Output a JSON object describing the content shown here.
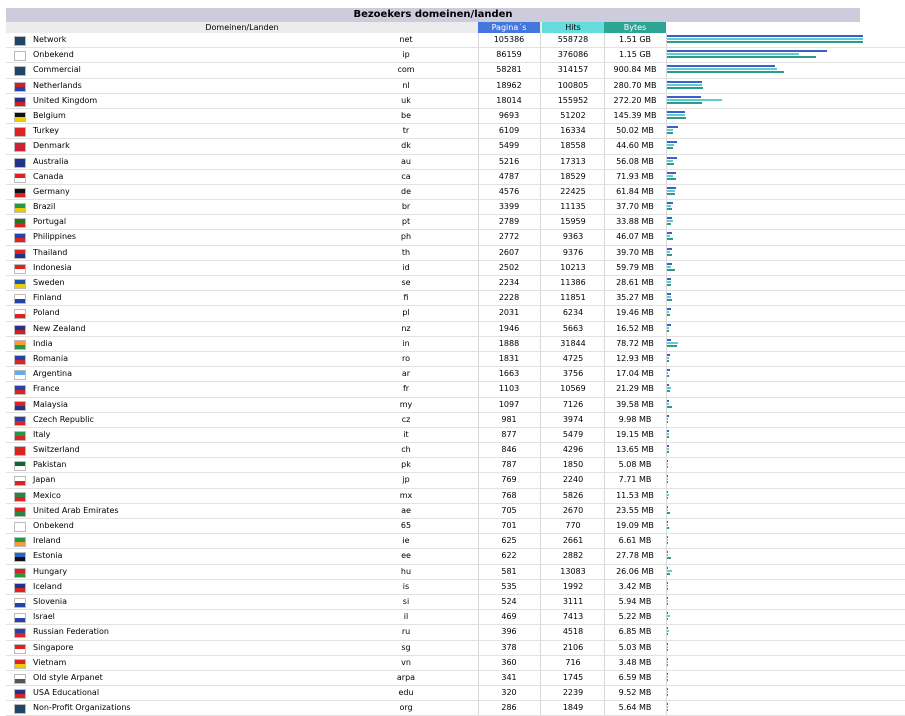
{
  "title": "Bezoekers domeinen/landen",
  "headers": {
    "domain": "Domeinen/Landen",
    "pages": "Pagina´s",
    "hits": "Hits",
    "bytes": "Bytes"
  },
  "colors": {
    "title_bg": "#ccccdd",
    "pages": "#4477dd",
    "hits": "#66dddd",
    "bytes": "#2ea495"
  },
  "rows": [
    {
      "icon": "network-globe-icon",
      "flag": [
        "#224466",
        "#224466"
      ],
      "name": "Network",
      "code": "net",
      "pages": "105386",
      "hits": "558728",
      "bytes": "1.51 GB",
      "pv": 105386,
      "hv": 558728,
      "bv": 1.51
    },
    {
      "icon": "unknown-icon",
      "flag": [
        "#ffffff",
        "#ffffff"
      ],
      "name": "Onbekend",
      "code": "ip",
      "pages": "86159",
      "hits": "376086",
      "bytes": "1.15 GB",
      "pv": 86159,
      "hv": 376086,
      "bv": 1.15
    },
    {
      "icon": "commercial-globe-icon",
      "flag": [
        "#224466",
        "#224466"
      ],
      "name": "Commercial",
      "code": "com",
      "pages": "58281",
      "hits": "314157",
      "bytes": "900.84 MB",
      "pv": 58281,
      "hv": 314157,
      "bv": 0.90084
    },
    {
      "icon": "flag-nl-icon",
      "flag": [
        "#cc2222",
        "#2244aa"
      ],
      "name": "Netherlands",
      "code": "nl",
      "pages": "18962",
      "hits": "100805",
      "bytes": "280.70 MB",
      "pv": 18962,
      "hv": 100805,
      "bv": 0.2807
    },
    {
      "icon": "flag-uk-icon",
      "flag": [
        "#22338a",
        "#cc2222"
      ],
      "name": "United Kingdom",
      "code": "uk",
      "pages": "18014",
      "hits": "155952",
      "bytes": "272.20 MB",
      "pv": 18014,
      "hv": 155952,
      "bv": 0.2722
    },
    {
      "icon": "flag-be-icon",
      "flag": [
        "#111111",
        "#eecc00"
      ],
      "name": "Belgium",
      "code": "be",
      "pages": "9693",
      "hits": "51202",
      "bytes": "145.39 MB",
      "pv": 9693,
      "hv": 51202,
      "bv": 0.14539
    },
    {
      "icon": "flag-tr-icon",
      "flag": [
        "#dd2222",
        "#dd2222"
      ],
      "name": "Turkey",
      "code": "tr",
      "pages": "6109",
      "hits": "16334",
      "bytes": "50.02 MB",
      "pv": 6109,
      "hv": 16334,
      "bv": 0.05002
    },
    {
      "icon": "flag-dk-icon",
      "flag": [
        "#cc2233",
        "#cc2233"
      ],
      "name": "Denmark",
      "code": "dk",
      "pages": "5499",
      "hits": "18558",
      "bytes": "44.60 MB",
      "pv": 5499,
      "hv": 18558,
      "bv": 0.0446
    },
    {
      "icon": "flag-au-icon",
      "flag": [
        "#22338a",
        "#22338a"
      ],
      "name": "Australia",
      "code": "au",
      "pages": "5216",
      "hits": "17313",
      "bytes": "56.08 MB",
      "pv": 5216,
      "hv": 17313,
      "bv": 0.05608
    },
    {
      "icon": "flag-ca-icon",
      "flag": [
        "#dd2222",
        "#ffffff"
      ],
      "name": "Canada",
      "code": "ca",
      "pages": "4787",
      "hits": "18529",
      "bytes": "71.93 MB",
      "pv": 4787,
      "hv": 18529,
      "bv": 0.07193
    },
    {
      "icon": "flag-de-icon",
      "flag": [
        "#111111",
        "#dd2222"
      ],
      "name": "Germany",
      "code": "de",
      "pages": "4576",
      "hits": "22425",
      "bytes": "61.84 MB",
      "pv": 4576,
      "hv": 22425,
      "bv": 0.06184
    },
    {
      "icon": "flag-br-icon",
      "flag": [
        "#229944",
        "#eecc00"
      ],
      "name": "Brazil",
      "code": "br",
      "pages": "3399",
      "hits": "11135",
      "bytes": "37.70 MB",
      "pv": 3399,
      "hv": 11135,
      "bv": 0.0377
    },
    {
      "icon": "flag-pt-icon",
      "flag": [
        "#227722",
        "#dd2222"
      ],
      "name": "Portugal",
      "code": "pt",
      "pages": "2789",
      "hits": "15959",
      "bytes": "33.88 MB",
      "pv": 2789,
      "hv": 15959,
      "bv": 0.03388
    },
    {
      "icon": "flag-ph-icon",
      "flag": [
        "#2244aa",
        "#dd2222"
      ],
      "name": "Philippines",
      "code": "ph",
      "pages": "2772",
      "hits": "9363",
      "bytes": "46.07 MB",
      "pv": 2772,
      "hv": 9363,
      "bv": 0.04607
    },
    {
      "icon": "flag-th-icon",
      "flag": [
        "#dd2222",
        "#22338a"
      ],
      "name": "Thailand",
      "code": "th",
      "pages": "2607",
      "hits": "9376",
      "bytes": "39.70 MB",
      "pv": 2607,
      "hv": 9376,
      "bv": 0.0397
    },
    {
      "icon": "flag-id-icon",
      "flag": [
        "#dd2222",
        "#ffffff"
      ],
      "name": "Indonesia",
      "code": "id",
      "pages": "2502",
      "hits": "10213",
      "bytes": "59.79 MB",
      "pv": 2502,
      "hv": 10213,
      "bv": 0.05979
    },
    {
      "icon": "flag-se-icon",
      "flag": [
        "#2255aa",
        "#eecc00"
      ],
      "name": "Sweden",
      "code": "se",
      "pages": "2234",
      "hits": "11386",
      "bytes": "28.61 MB",
      "pv": 2234,
      "hv": 11386,
      "bv": 0.02861
    },
    {
      "icon": "flag-fi-icon",
      "flag": [
        "#ffffff",
        "#2244aa"
      ],
      "name": "Finland",
      "code": "fi",
      "pages": "2228",
      "hits": "11851",
      "bytes": "35.27 MB",
      "pv": 2228,
      "hv": 11851,
      "bv": 0.03527
    },
    {
      "icon": "flag-pl-icon",
      "flag": [
        "#ffffff",
        "#dd2222"
      ],
      "name": "Poland",
      "code": "pl",
      "pages": "2031",
      "hits": "6234",
      "bytes": "19.46 MB",
      "pv": 2031,
      "hv": 6234,
      "bv": 0.01946
    },
    {
      "icon": "flag-nz-icon",
      "flag": [
        "#22338a",
        "#cc2222"
      ],
      "name": "New Zealand",
      "code": "nz",
      "pages": "1946",
      "hits": "5663",
      "bytes": "16.52 MB",
      "pv": 1946,
      "hv": 5663,
      "bv": 0.01652
    },
    {
      "icon": "flag-in-icon",
      "flag": [
        "#ff9933",
        "#229944"
      ],
      "name": "India",
      "code": "in",
      "pages": "1888",
      "hits": "31844",
      "bytes": "78.72 MB",
      "pv": 1888,
      "hv": 31844,
      "bv": 0.07872
    },
    {
      "icon": "flag-ro-icon",
      "flag": [
        "#2244aa",
        "#dd2222"
      ],
      "name": "Romania",
      "code": "ro",
      "pages": "1831",
      "hits": "4725",
      "bytes": "12.93 MB",
      "pv": 1831,
      "hv": 4725,
      "bv": 0.01293
    },
    {
      "icon": "flag-ar-icon",
      "flag": [
        "#66aaee",
        "#ffffff"
      ],
      "name": "Argentina",
      "code": "ar",
      "pages": "1663",
      "hits": "3756",
      "bytes": "17.04 MB",
      "pv": 1663,
      "hv": 3756,
      "bv": 0.01704
    },
    {
      "icon": "flag-fr-icon",
      "flag": [
        "#2244aa",
        "#dd2222"
      ],
      "name": "France",
      "code": "fr",
      "pages": "1103",
      "hits": "10569",
      "bytes": "21.29 MB",
      "pv": 1103,
      "hv": 10569,
      "bv": 0.02129
    },
    {
      "icon": "flag-my-icon",
      "flag": [
        "#dd2222",
        "#22338a"
      ],
      "name": "Malaysia",
      "code": "my",
      "pages": "1097",
      "hits": "7126",
      "bytes": "39.58 MB",
      "pv": 1097,
      "hv": 7126,
      "bv": 0.03958
    },
    {
      "icon": "flag-cz-icon",
      "flag": [
        "#2244aa",
        "#dd2222"
      ],
      "name": "Czech Republic",
      "code": "cz",
      "pages": "981",
      "hits": "3974",
      "bytes": "9.98 MB",
      "pv": 981,
      "hv": 3974,
      "bv": 0.00998
    },
    {
      "icon": "flag-it-icon",
      "flag": [
        "#229944",
        "#dd2222"
      ],
      "name": "Italy",
      "code": "it",
      "pages": "877",
      "hits": "5479",
      "bytes": "19.15 MB",
      "pv": 877,
      "hv": 5479,
      "bv": 0.01915
    },
    {
      "icon": "flag-ch-icon",
      "flag": [
        "#dd2222",
        "#dd2222"
      ],
      "name": "Switzerland",
      "code": "ch",
      "pages": "846",
      "hits": "4296",
      "bytes": "13.65 MB",
      "pv": 846,
      "hv": 4296,
      "bv": 0.01365
    },
    {
      "icon": "flag-pk-icon",
      "flag": [
        "#116633",
        "#ffffff"
      ],
      "name": "Pakistan",
      "code": "pk",
      "pages": "787",
      "hits": "1850",
      "bytes": "5.08 MB",
      "pv": 787,
      "hv": 1850,
      "bv": 0.00508
    },
    {
      "icon": "flag-jp-icon",
      "flag": [
        "#ffffff",
        "#dd2222"
      ],
      "name": "Japan",
      "code": "jp",
      "pages": "769",
      "hits": "2240",
      "bytes": "7.71 MB",
      "pv": 769,
      "hv": 2240,
      "bv": 0.00771
    },
    {
      "icon": "flag-mx-icon",
      "flag": [
        "#228844",
        "#dd2222"
      ],
      "name": "Mexico",
      "code": "mx",
      "pages": "768",
      "hits": "5826",
      "bytes": "11.53 MB",
      "pv": 768,
      "hv": 5826,
      "bv": 0.01153
    },
    {
      "icon": "flag-ae-icon",
      "flag": [
        "#dd2222",
        "#228844"
      ],
      "name": "United Arab Emirates",
      "code": "ae",
      "pages": "705",
      "hits": "2670",
      "bytes": "23.55 MB",
      "pv": 705,
      "hv": 2670,
      "bv": 0.02355
    },
    {
      "icon": "unknown-icon",
      "flag": [
        "#ffffff",
        "#ffffff"
      ],
      "name": "Onbekend",
      "code": "65",
      "pages": "701",
      "hits": "770",
      "bytes": "19.09 MB",
      "pv": 701,
      "hv": 770,
      "bv": 0.01909
    },
    {
      "icon": "flag-ie-icon",
      "flag": [
        "#229944",
        "#ff9933"
      ],
      "name": "Ireland",
      "code": "ie",
      "pages": "625",
      "hits": "2661",
      "bytes": "6.61 MB",
      "pv": 625,
      "hv": 2661,
      "bv": 0.00661
    },
    {
      "icon": "flag-ee-icon",
      "flag": [
        "#2266cc",
        "#111111"
      ],
      "name": "Estonia",
      "code": "ee",
      "pages": "622",
      "hits": "2882",
      "bytes": "27.78 MB",
      "pv": 622,
      "hv": 2882,
      "bv": 0.02778
    },
    {
      "icon": "flag-hu-icon",
      "flag": [
        "#dd2222",
        "#229944"
      ],
      "name": "Hungary",
      "code": "hu",
      "pages": "581",
      "hits": "13083",
      "bytes": "26.06 MB",
      "pv": 581,
      "hv": 13083,
      "bv": 0.02606
    },
    {
      "icon": "flag-is-icon",
      "flag": [
        "#22338a",
        "#dd2222"
      ],
      "name": "Iceland",
      "code": "is",
      "pages": "535",
      "hits": "1992",
      "bytes": "3.42 MB",
      "pv": 535,
      "hv": 1992,
      "bv": 0.00342
    },
    {
      "icon": "flag-si-icon",
      "flag": [
        "#ffffff",
        "#2244aa"
      ],
      "name": "Slovenia",
      "code": "si",
      "pages": "524",
      "hits": "3111",
      "bytes": "5.94 MB",
      "pv": 524,
      "hv": 3111,
      "bv": 0.00594
    },
    {
      "icon": "flag-il-icon",
      "flag": [
        "#ffffff",
        "#2244aa"
      ],
      "name": "Israel",
      "code": "il",
      "pages": "469",
      "hits": "7413",
      "bytes": "5.22 MB",
      "pv": 469,
      "hv": 7413,
      "bv": 0.00522
    },
    {
      "icon": "flag-ru-icon",
      "flag": [
        "#2244aa",
        "#dd2222"
      ],
      "name": "Russian Federation",
      "code": "ru",
      "pages": "396",
      "hits": "4518",
      "bytes": "6.85 MB",
      "pv": 396,
      "hv": 4518,
      "bv": 0.00685
    },
    {
      "icon": "flag-sg-icon",
      "flag": [
        "#dd2222",
        "#ffffff"
      ],
      "name": "Singapore",
      "code": "sg",
      "pages": "378",
      "hits": "2106",
      "bytes": "5.03 MB",
      "pv": 378,
      "hv": 2106,
      "bv": 0.00503
    },
    {
      "icon": "flag-vn-icon",
      "flag": [
        "#dd2222",
        "#eecc00"
      ],
      "name": "Vietnam",
      "code": "vn",
      "pages": "360",
      "hits": "716",
      "bytes": "3.48 MB",
      "pv": 360,
      "hv": 716,
      "bv": 0.00348
    },
    {
      "icon": "arpanet-icon",
      "flag": [
        "#ffffff",
        "#555555"
      ],
      "name": "Old style Arpanet",
      "code": "arpa",
      "pages": "341",
      "hits": "1745",
      "bytes": "6.59 MB",
      "pv": 341,
      "hv": 1745,
      "bv": 0.00659
    },
    {
      "icon": "flag-us-icon",
      "flag": [
        "#22338a",
        "#dd2222"
      ],
      "name": "USA Educational",
      "code": "edu",
      "pages": "320",
      "hits": "2239",
      "bytes": "9.52 MB",
      "pv": 320,
      "hv": 2239,
      "bv": 0.00952
    },
    {
      "icon": "nonprofit-globe-icon",
      "flag": [
        "#224466",
        "#224466"
      ],
      "name": "Non-Profit Organizations",
      "code": "org",
      "pages": "286",
      "hits": "1849",
      "bytes": "5.64 MB",
      "pv": 286,
      "hv": 1849,
      "bv": 0.00564
    }
  ]
}
